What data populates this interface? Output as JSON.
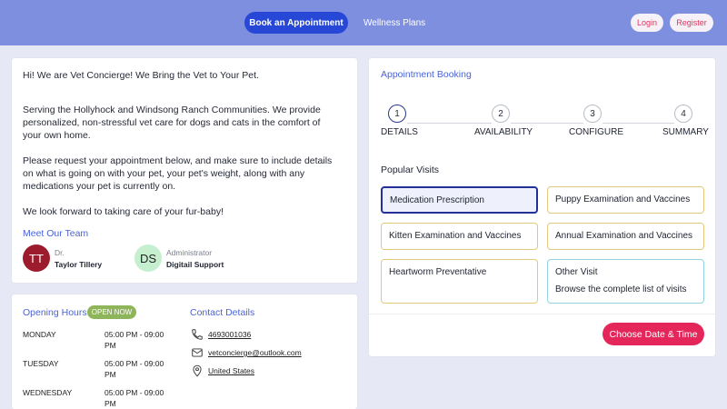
{
  "nav": {
    "book_label": "Book an Appointment",
    "wellness_label": "Wellness Plans",
    "login_label": "Login",
    "register_label": "Register"
  },
  "intro": {
    "headline": "Hi! We are Vet Concierge! We Bring the Vet to Your Pet.",
    "para1": "Serving the Hollyhock and Windsong Ranch Communities. We provide personalized, non-stressful vet care for dogs and cats in the comfort of your own home.",
    "para2": "Please request your appointment below, and make sure to include details on what is going on with your pet, your pet's weight, along with any medications your pet is currently on.",
    "para3": "We look forward to taking care of your fur-baby!",
    "team_title": "Meet Our Team",
    "team": [
      {
        "initials": "TT",
        "role": "Dr.",
        "name": "Taylor Tillery",
        "color": "#9c1c2e"
      },
      {
        "initials": "DS",
        "role": "Administrator",
        "name": "Digitail Support",
        "color": "#c6efcf"
      }
    ]
  },
  "hours": {
    "title": "Opening Hours",
    "badge": "OPEN NOW",
    "rows": [
      {
        "day": "MONDAY",
        "time": "05:00 PM - 09:00 PM"
      },
      {
        "day": "TUESDAY",
        "time": "05:00 PM - 09:00 PM"
      },
      {
        "day": "WEDNESDAY",
        "time": "05:00 PM - 09:00 PM"
      }
    ]
  },
  "contact": {
    "title": "Contact Details",
    "phone": "4693001036",
    "email": "vetconcierge@outlook.com",
    "location": "United States"
  },
  "booking": {
    "title": "Appointment Booking",
    "steps": [
      {
        "num": "1",
        "label": "DETAILS"
      },
      {
        "num": "2",
        "label": "AVAILABILITY"
      },
      {
        "num": "3",
        "label": "CONFIGURE"
      },
      {
        "num": "4",
        "label": "SUMMARY"
      }
    ],
    "popular_title": "Popular Visits",
    "visits": [
      "Medication Prescription",
      "Puppy Examination and Vaccines",
      "Kitten Examination and Vaccines",
      "Annual Examination and Vaccines",
      "Heartworm Preventative",
      "Other Visit"
    ],
    "other_desc": "Browse the complete list of visits",
    "cta": "Choose Date & Time"
  },
  "colors": {
    "topbar": "#7e8fe0",
    "primary": "#2747d6",
    "accent": "#e5265a",
    "open_badge": "#8fb55a"
  }
}
